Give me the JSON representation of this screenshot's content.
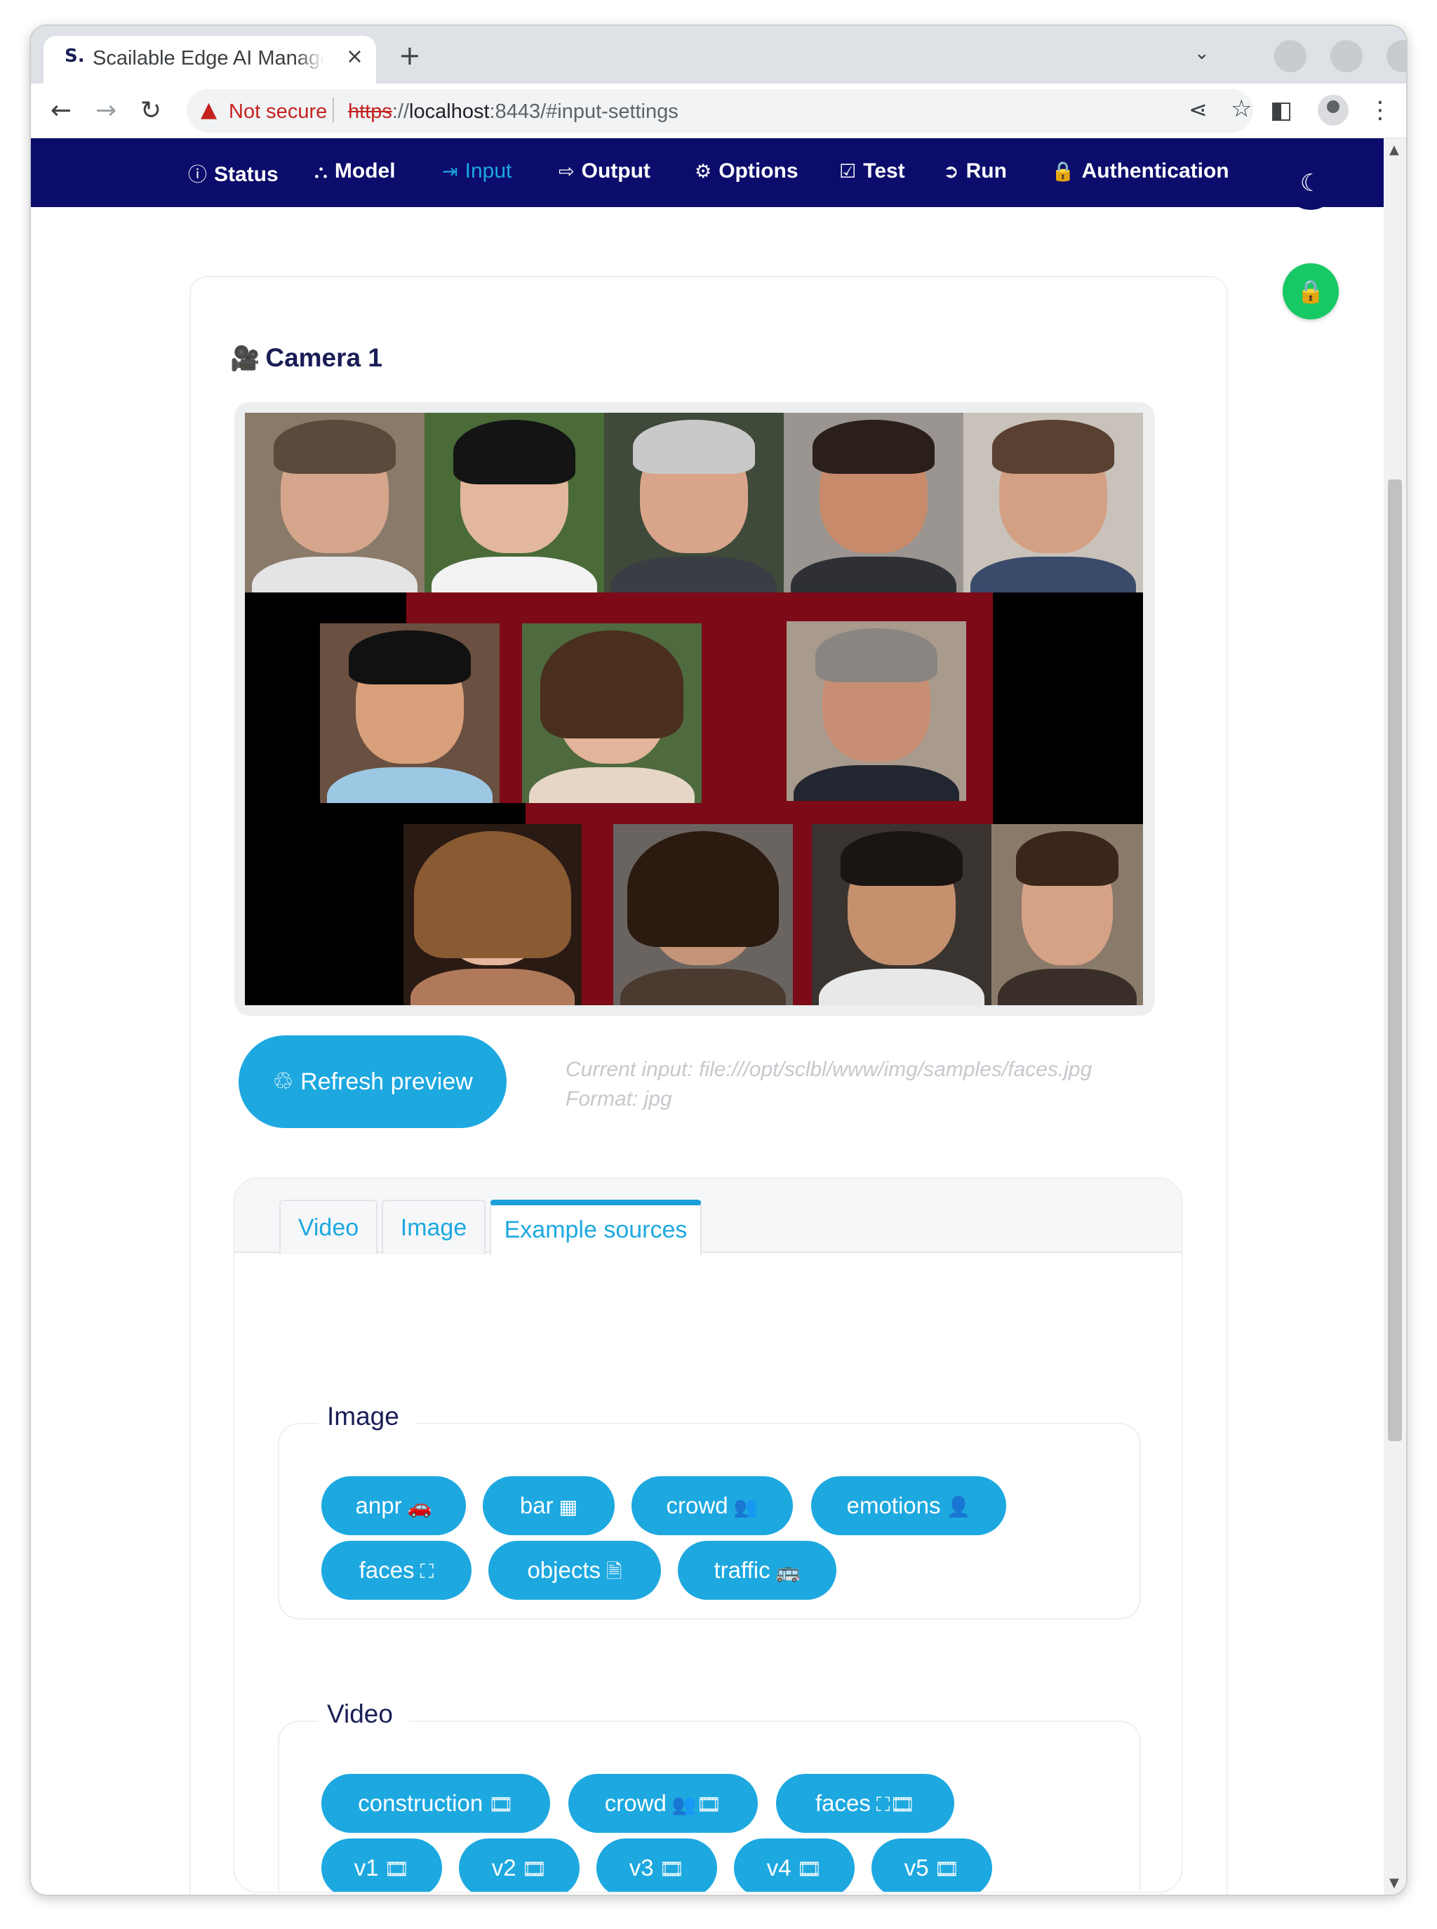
{
  "browser": {
    "tab_favicon": "S.",
    "tab_title": "Scailable Edge AI Manager",
    "tab_close": "×",
    "new_tab": "+",
    "address": {
      "security_label": "Not secure",
      "scheme": "https",
      "host": "localhost",
      "rest": ":8443/#input-settings"
    }
  },
  "nav": {
    "items": [
      {
        "label": "Status",
        "icon": "info-circle-icon",
        "glyph": "ⓘ"
      },
      {
        "label": "Model",
        "icon": "diagram-icon",
        "glyph": "⛬"
      },
      {
        "label": "Input",
        "icon": "sign-in-icon",
        "glyph": "⇥",
        "active": true
      },
      {
        "label": "Output",
        "icon": "sign-out-icon",
        "glyph": "⇨"
      },
      {
        "label": "Options",
        "icon": "gear-icon",
        "glyph": "⚙"
      },
      {
        "label": "Test",
        "icon": "checkbox-icon",
        "glyph": "☑"
      },
      {
        "label": "Run",
        "icon": "arrow-circle-icon",
        "glyph": "➲"
      },
      {
        "label": "Authentication",
        "icon": "lock-icon",
        "glyph": "🔒"
      }
    ],
    "accent": "#1da8e0",
    "background": "#0c0c6c"
  },
  "camera": {
    "title": "Camera 1"
  },
  "preview": {
    "refresh_label": "Refresh preview",
    "current_input": "Current input: file:///opt/sclbl/www/img/samples/faces.jpg",
    "format": "Format: jpg"
  },
  "tabs": [
    "Video",
    "Image",
    "Example sources"
  ],
  "active_tab": "Example sources",
  "examples": {
    "image": {
      "legend": "Image",
      "items": [
        {
          "label": "anpr",
          "icon": "car-icon",
          "glyph": "🚗"
        },
        {
          "label": "bar",
          "icon": "qrcode-icon",
          "glyph": "▦"
        },
        {
          "label": "crowd",
          "icon": "users-icon",
          "glyph": "👥"
        },
        {
          "label": "emotions",
          "icon": "user-plus-icon",
          "glyph": "👤"
        },
        {
          "label": "faces",
          "icon": "face-frame-icon",
          "glyph": "⛶"
        },
        {
          "label": "objects",
          "icon": "file-icon",
          "glyph": "🗎"
        },
        {
          "label": "traffic",
          "icon": "bus-icon",
          "glyph": "🚌"
        }
      ]
    },
    "video": {
      "legend": "Video",
      "items": [
        {
          "label": "construction",
          "icon": "film-icon",
          "glyph": "🎞"
        },
        {
          "label": "crowd",
          "icon": "users-film-icon",
          "glyph": "👥🎞"
        },
        {
          "label": "faces",
          "icon": "face-film-icon",
          "glyph": "⛶🎞"
        },
        {
          "label": "v1",
          "icon": "film-icon",
          "glyph": "🎞"
        },
        {
          "label": "v2",
          "icon": "film-icon",
          "glyph": "🎞"
        },
        {
          "label": "v3",
          "icon": "film-icon",
          "glyph": "🎞"
        },
        {
          "label": "v4",
          "icon": "film-icon",
          "glyph": "🎞"
        },
        {
          "label": "v5",
          "icon": "film-icon",
          "glyph": "🎞"
        }
      ]
    }
  }
}
